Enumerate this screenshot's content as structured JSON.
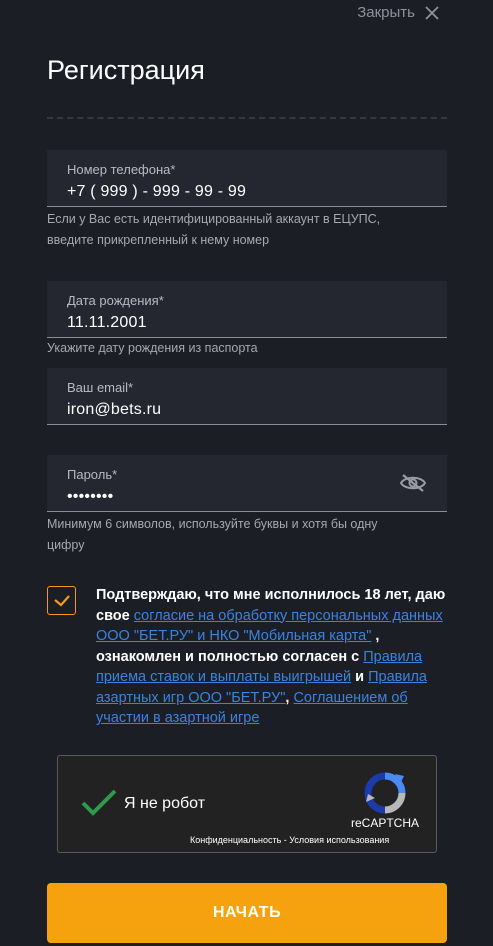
{
  "header": {
    "close_label": "Закрыть",
    "title": "Регистрация"
  },
  "phone": {
    "label": "Номер телефона*",
    "value": "+7 ( 999 ) - 999 - 99 - 99",
    "hint_line1": "Если у Вас есть идентифицированный аккаунт в ЕЦУПС,",
    "hint_line2": "введите прикрепленный к нему номер"
  },
  "birthdate": {
    "label": "Дата рождения*",
    "value": "11.11.2001",
    "hint": "Укажите дату рождения из паспорта"
  },
  "email": {
    "label": "Ваш email*",
    "value": "iron@bets.ru"
  },
  "password": {
    "label": "Пароль*",
    "value": "••••••••",
    "hint_line1": "Минимум 6 символов, используйте буквы и хотя бы одну",
    "hint_line2": "цифру"
  },
  "consent": {
    "checked": true,
    "text_1": "Подтверждаю, что мне исполнилось 18 лет, даю свое ",
    "link_1": "согласие на обработку персональных данных ООО \"БЕТ.РУ\" и НКО \"Мобильная карта\"",
    "text_2": " , ознакомлен и полностью согласен с ",
    "link_2": "Правила приема ставок и выплаты выигрышей",
    "text_3": " и ",
    "link_3": "Правила азартных игр ООО \"БЕТ.РУ\"",
    "text_4": ", ",
    "link_4": "Соглашением об участии в азартной игре"
  },
  "recaptcha": {
    "label": "Я не робот",
    "brand": "reCAPTCHA",
    "privacy": "Конфиденциальность",
    "separator": " - ",
    "terms": "Условия использования"
  },
  "submit": {
    "label": "НАЧАТЬ"
  },
  "colors": {
    "background": "#1c1e26",
    "field_bg": "#252730",
    "accent": "#f5a20e",
    "link": "#3a83e0",
    "checkmark_green": "#2e9a4b"
  },
  "icons": {
    "close": "close-icon",
    "eye": "eye-off-icon",
    "check": "checkmark-icon",
    "recaptcha": "recaptcha-logo-icon"
  }
}
